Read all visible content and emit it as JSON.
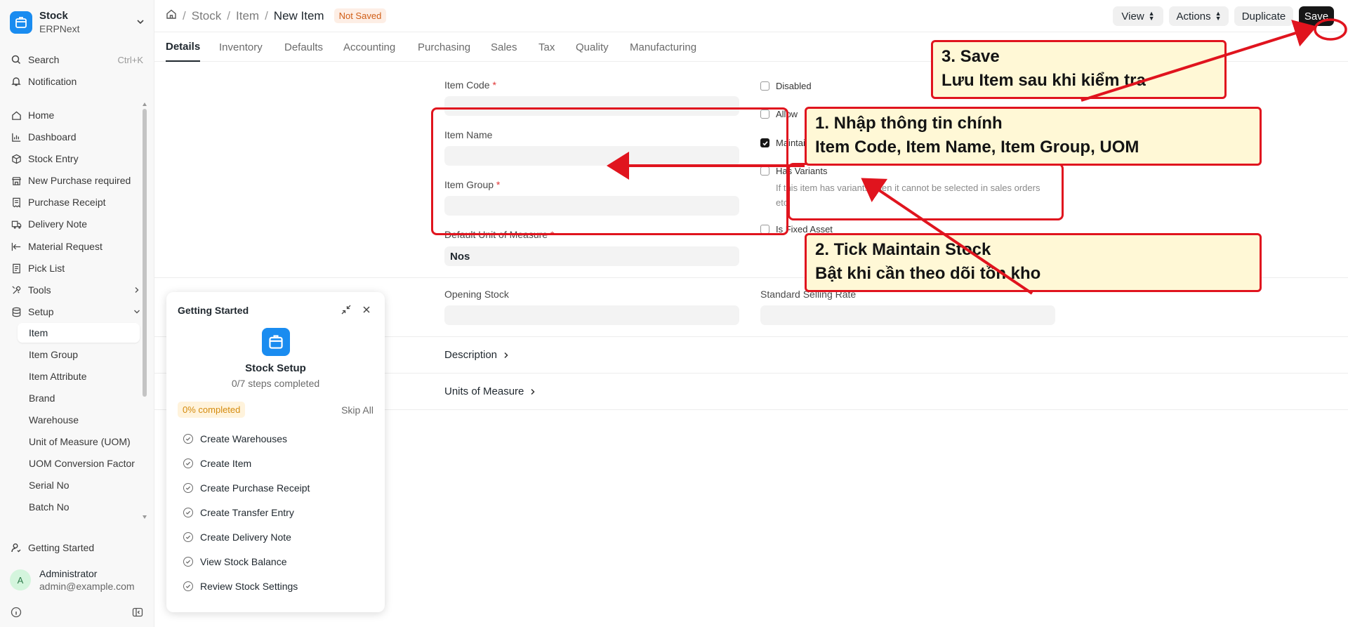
{
  "app": {
    "title": "Stock",
    "subtitle": "ERPNext"
  },
  "sidebar": {
    "search_label": "Search",
    "search_shortcut": "Ctrl+K",
    "notification_label": "Notification",
    "items": [
      {
        "label": "Home",
        "icon": "home-icon"
      },
      {
        "label": "Dashboard",
        "icon": "chart-icon"
      },
      {
        "label": "Stock Entry",
        "icon": "box-icon"
      },
      {
        "label": "New Purchase required",
        "icon": "store-icon"
      },
      {
        "label": "Purchase Receipt",
        "icon": "receipt-icon"
      },
      {
        "label": "Delivery Note",
        "icon": "truck-icon"
      },
      {
        "label": "Material Request",
        "icon": "arrow-in-icon"
      },
      {
        "label": "Pick List",
        "icon": "list-icon"
      },
      {
        "label": "Tools",
        "icon": "tools-icon"
      },
      {
        "label": "Setup",
        "icon": "database-icon"
      }
    ],
    "setup_children": [
      "Item",
      "Item Group",
      "Item Attribute",
      "Brand",
      "Warehouse",
      "Unit of Measure (UOM)",
      "UOM Conversion Factor",
      "Serial No",
      "Batch No"
    ],
    "active_child": "Item",
    "getting_started": "Getting Started",
    "user": {
      "initial": "A",
      "name": "Administrator",
      "email": "admin@example.com"
    }
  },
  "topbar": {
    "breadcrumbs": [
      "Stock",
      "Item"
    ],
    "current": "New Item",
    "status_badge": "Not Saved",
    "view_label": "View",
    "actions_label": "Actions",
    "duplicate_label": "Duplicate",
    "save_label": "Save"
  },
  "tabs": [
    "Details",
    "Inventory",
    "Defaults",
    "Accounting",
    "Purchasing",
    "Sales",
    "Tax",
    "Quality",
    "Manufacturing"
  ],
  "active_tab": "Details",
  "form": {
    "item_code_label": "Item Code",
    "item_code_value": "",
    "item_name_label": "Item Name",
    "item_name_value": "",
    "item_group_label": "Item Group",
    "item_group_value": "",
    "uom_label": "Default Unit of Measure",
    "uom_value": "Nos",
    "disabled_label": "Disabled",
    "disabled_checked": false,
    "allow_label": "Allow",
    "allow_checked": false,
    "maintain_label": "Maintain",
    "maintain_checked": true,
    "has_variants_label": "Has Variants",
    "has_variants_checked": false,
    "has_variants_help": "If this item has variants, then it cannot be selected in sales orders etc.",
    "fixed_asset_label": "Is Fixed Asset",
    "fixed_asset_checked": false,
    "opening_stock_label": "Opening Stock",
    "opening_stock_value": "",
    "selling_rate_label": "Standard Selling Rate",
    "selling_rate_value": "",
    "description_label": "Description",
    "uom_section_label": "Units of Measure"
  },
  "getting_started": {
    "title": "Getting Started",
    "module": "Stock Setup",
    "steps_text": "0/7 steps completed",
    "percent_text": "0% completed",
    "skip_label": "Skip All",
    "steps": [
      "Create Warehouses",
      "Create Item",
      "Create Purchase Receipt",
      "Create Transfer Entry",
      "Create Delivery Note",
      "View Stock Balance",
      "Review Stock Settings"
    ]
  },
  "annotations": {
    "note1_line1": "1. Nhập thông tin chính",
    "note1_line2": "Item Code, Item Name, Item Group, UOM",
    "note2_line1": "2. Tick Maintain Stock",
    "note2_line2": "Bật khi cần theo dõi tồn kho",
    "note3_line1": "3. Save",
    "note3_line2": "Lưu Item sau khi kiểm tra",
    "annotation_color": "#e0141e",
    "note_bg": "#fff8d6"
  },
  "colors": {
    "accent": "#1a8cf0",
    "primary_button": "#171717",
    "badge_text": "#d05e17"
  }
}
